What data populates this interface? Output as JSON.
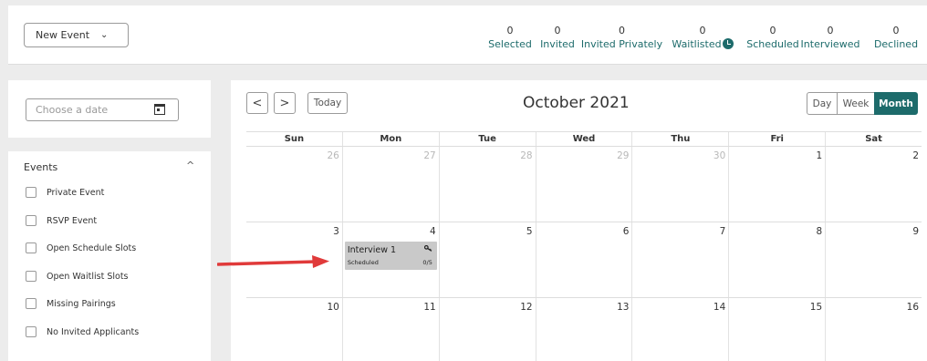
{
  "toolbar": {
    "new_event_label": "New Event",
    "chevron": "⌄"
  },
  "stats": [
    {
      "count": "0",
      "label": "Selected"
    },
    {
      "count": "0",
      "label": "Invited"
    },
    {
      "count": "0",
      "label": "Invited Privately"
    },
    {
      "count": "0",
      "label": "Waitlisted"
    },
    {
      "count": "0",
      "label": "Scheduled"
    },
    {
      "count": "0",
      "label": "Interviewed"
    },
    {
      "count": "0",
      "label": "Declined"
    }
  ],
  "datepicker": {
    "placeholder": "Choose a date"
  },
  "events_panel": {
    "title": "Events",
    "caret": "^",
    "filters": [
      "Private Event",
      "RSVP Event",
      "Open Schedule Slots",
      "Open Waitlist Slots",
      "Missing Pairings",
      "No Invited Applicants"
    ]
  },
  "calendar": {
    "prev": "<",
    "next": ">",
    "today_label": "Today",
    "month_title": "October 2021",
    "views": [
      "Day",
      "Week",
      "Month"
    ],
    "active_view": "Month",
    "weekdays": [
      "Sun",
      "Mon",
      "Tue",
      "Wed",
      "Thu",
      "Fri",
      "Sat"
    ],
    "weeks": [
      [
        "26",
        "27",
        "28",
        "29",
        "30",
        "1",
        "2"
      ],
      [
        "3",
        "4",
        "5",
        "6",
        "7",
        "8",
        "9"
      ],
      [
        "10",
        "11",
        "12",
        "13",
        "14",
        "15",
        "16"
      ]
    ],
    "event": {
      "title": "Interview 1",
      "status": "Scheduled",
      "count": "0/5"
    }
  },
  "colors": {
    "accent": "#1d6b6b",
    "arrow": "#e03a3a",
    "event_bg": "#c9c9c9"
  },
  "icons": {
    "calendar": "calendar-icon",
    "waitlist": "clock-icon",
    "event": "key-icon"
  }
}
